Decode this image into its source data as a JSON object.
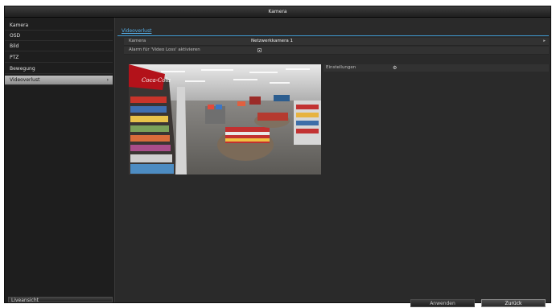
{
  "window": {
    "title": "Kamera"
  },
  "sidebar": {
    "items": [
      {
        "label": "Kamera",
        "active": false
      },
      {
        "label": "OSD",
        "active": false
      },
      {
        "label": "Bild",
        "active": false
      },
      {
        "label": "PTZ",
        "active": false
      },
      {
        "label": "Bewegung",
        "active": false
      },
      {
        "label": "Videoverlust",
        "active": true
      }
    ],
    "chevron": "›",
    "live_view_label": "Liveansicht"
  },
  "main": {
    "tabs": [
      {
        "label": "Videoverlust"
      }
    ],
    "fields": {
      "camera_label": "Kamera",
      "camera_value": "Netzwerkkamera 1",
      "alarm_label": "Alarm für 'Video Loss' aktivieren",
      "alarm_checked": true
    },
    "settings": {
      "label": "Einstellungen",
      "icon": "gear-icon"
    },
    "preview": {
      "sign_text": "Coca-Cola"
    }
  },
  "buttons": {
    "apply": "Anwenden",
    "back": "Zurück"
  },
  "colors": {
    "accent": "#56b0ea",
    "background": "#2a2a2a"
  }
}
